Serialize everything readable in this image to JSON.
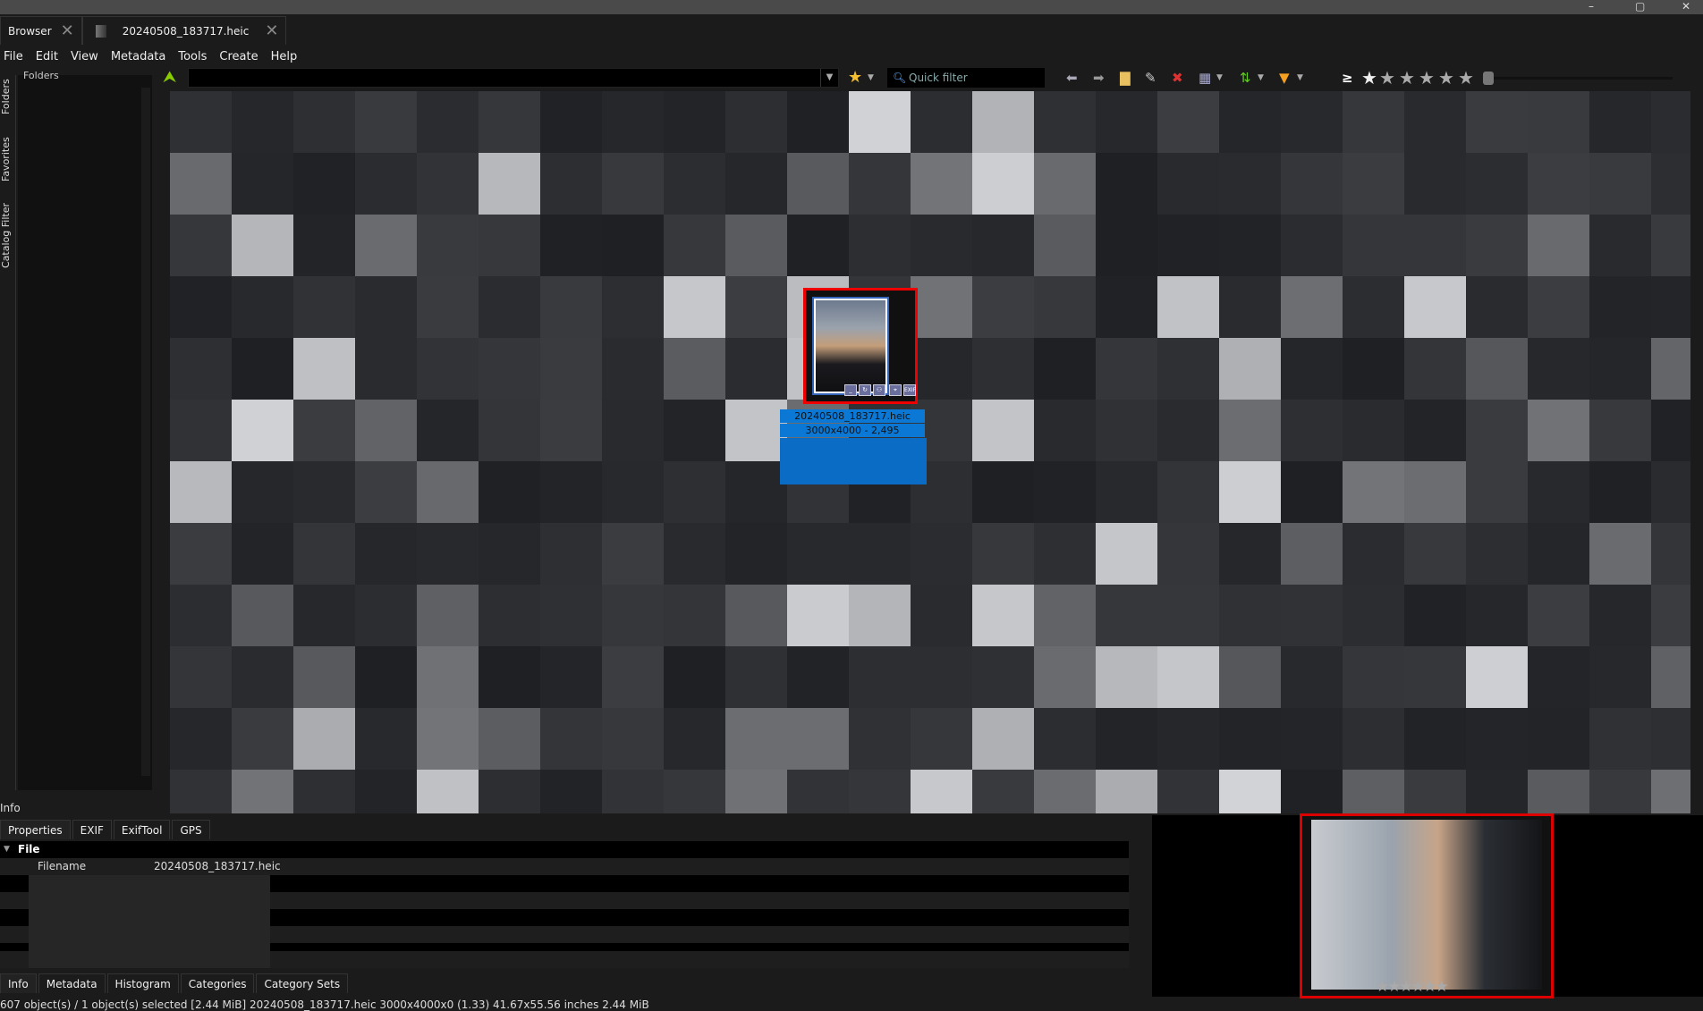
{
  "window": {
    "controls": [
      "–",
      "▢",
      "✕"
    ]
  },
  "tabs": [
    {
      "label": "Browser"
    },
    {
      "label": "20240508_183717.heic"
    }
  ],
  "menu": [
    "File",
    "Edit",
    "View",
    "Metadata",
    "Tools",
    "Create",
    "Help"
  ],
  "sidebar": {
    "vertical_tabs": [
      "Folders",
      "Favorites",
      "Catalog Filter"
    ],
    "folders_title": "Folders"
  },
  "toolbar": {
    "quick_filter_placeholder": "Quick filter",
    "rating_ge": "≥",
    "rating_stars": [
      "1",
      "2",
      "3",
      "4",
      "5"
    ]
  },
  "selected_thumbnail": {
    "filename": "20240508_183717.heic",
    "info": "3000x4000 - 2,495",
    "overlay_icons": [
      "_",
      "↻",
      "⚇",
      "⌖",
      "EXIF"
    ]
  },
  "info_panel": {
    "title": "Info",
    "tabs": [
      "Properties",
      "EXIF",
      "ExifTool",
      "GPS"
    ],
    "group": "File",
    "rows": [
      {
        "label": "Filename",
        "value": "20240508_183717.heic"
      }
    ],
    "bottom_tabs": [
      "Info",
      "Metadata",
      "Histogram",
      "Categories",
      "Category Sets"
    ]
  },
  "status_bar": "607 object(s) / 1 object(s) selected [2.44 MiB]  20240508_183717.heic  3000x4000x0 (1.33)  41.67x55.56 inches  2.44 MiB",
  "colors": {
    "accent": "#0a78d4",
    "selection_border": "#e00000"
  }
}
